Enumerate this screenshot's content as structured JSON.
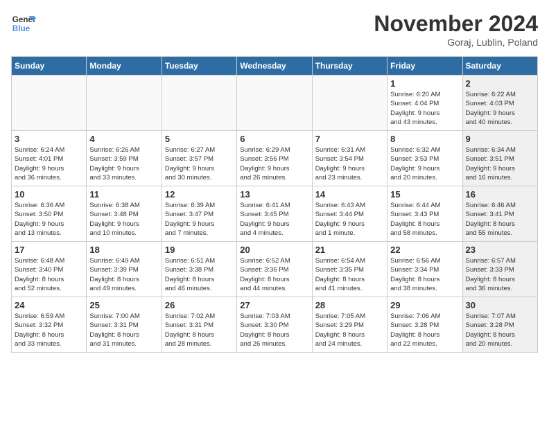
{
  "logo": {
    "line1": "General",
    "line2": "Blue"
  },
  "title": "November 2024",
  "subtitle": "Goraj, Lublin, Poland",
  "days_of_week": [
    "Sunday",
    "Monday",
    "Tuesday",
    "Wednesday",
    "Thursday",
    "Friday",
    "Saturday"
  ],
  "weeks": [
    [
      {
        "day": "",
        "text": "",
        "shaded": false,
        "empty": true
      },
      {
        "day": "",
        "text": "",
        "shaded": false,
        "empty": true
      },
      {
        "day": "",
        "text": "",
        "shaded": false,
        "empty": true
      },
      {
        "day": "",
        "text": "",
        "shaded": false,
        "empty": true
      },
      {
        "day": "",
        "text": "",
        "shaded": false,
        "empty": true
      },
      {
        "day": "1",
        "text": "Sunrise: 6:20 AM\nSunset: 4:04 PM\nDaylight: 9 hours\nand 43 minutes.",
        "shaded": false,
        "empty": false
      },
      {
        "day": "2",
        "text": "Sunrise: 6:22 AM\nSunset: 4:03 PM\nDaylight: 9 hours\nand 40 minutes.",
        "shaded": true,
        "empty": false
      }
    ],
    [
      {
        "day": "3",
        "text": "Sunrise: 6:24 AM\nSunset: 4:01 PM\nDaylight: 9 hours\nand 36 minutes.",
        "shaded": false,
        "empty": false
      },
      {
        "day": "4",
        "text": "Sunrise: 6:26 AM\nSunset: 3:59 PM\nDaylight: 9 hours\nand 33 minutes.",
        "shaded": false,
        "empty": false
      },
      {
        "day": "5",
        "text": "Sunrise: 6:27 AM\nSunset: 3:57 PM\nDaylight: 9 hours\nand 30 minutes.",
        "shaded": false,
        "empty": false
      },
      {
        "day": "6",
        "text": "Sunrise: 6:29 AM\nSunset: 3:56 PM\nDaylight: 9 hours\nand 26 minutes.",
        "shaded": false,
        "empty": false
      },
      {
        "day": "7",
        "text": "Sunrise: 6:31 AM\nSunset: 3:54 PM\nDaylight: 9 hours\nand 23 minutes.",
        "shaded": false,
        "empty": false
      },
      {
        "day": "8",
        "text": "Sunrise: 6:32 AM\nSunset: 3:53 PM\nDaylight: 9 hours\nand 20 minutes.",
        "shaded": false,
        "empty": false
      },
      {
        "day": "9",
        "text": "Sunrise: 6:34 AM\nSunset: 3:51 PM\nDaylight: 9 hours\nand 16 minutes.",
        "shaded": true,
        "empty": false
      }
    ],
    [
      {
        "day": "10",
        "text": "Sunrise: 6:36 AM\nSunset: 3:50 PM\nDaylight: 9 hours\nand 13 minutes.",
        "shaded": false,
        "empty": false
      },
      {
        "day": "11",
        "text": "Sunrise: 6:38 AM\nSunset: 3:48 PM\nDaylight: 9 hours\nand 10 minutes.",
        "shaded": false,
        "empty": false
      },
      {
        "day": "12",
        "text": "Sunrise: 6:39 AM\nSunset: 3:47 PM\nDaylight: 9 hours\nand 7 minutes.",
        "shaded": false,
        "empty": false
      },
      {
        "day": "13",
        "text": "Sunrise: 6:41 AM\nSunset: 3:45 PM\nDaylight: 9 hours\nand 4 minutes.",
        "shaded": false,
        "empty": false
      },
      {
        "day": "14",
        "text": "Sunrise: 6:43 AM\nSunset: 3:44 PM\nDaylight: 9 hours\nand 1 minute.",
        "shaded": false,
        "empty": false
      },
      {
        "day": "15",
        "text": "Sunrise: 6:44 AM\nSunset: 3:43 PM\nDaylight: 8 hours\nand 58 minutes.",
        "shaded": false,
        "empty": false
      },
      {
        "day": "16",
        "text": "Sunrise: 6:46 AM\nSunset: 3:41 PM\nDaylight: 8 hours\nand 55 minutes.",
        "shaded": true,
        "empty": false
      }
    ],
    [
      {
        "day": "17",
        "text": "Sunrise: 6:48 AM\nSunset: 3:40 PM\nDaylight: 8 hours\nand 52 minutes.",
        "shaded": false,
        "empty": false
      },
      {
        "day": "18",
        "text": "Sunrise: 6:49 AM\nSunset: 3:39 PM\nDaylight: 8 hours\nand 49 minutes.",
        "shaded": false,
        "empty": false
      },
      {
        "day": "19",
        "text": "Sunrise: 6:51 AM\nSunset: 3:38 PM\nDaylight: 8 hours\nand 46 minutes.",
        "shaded": false,
        "empty": false
      },
      {
        "day": "20",
        "text": "Sunrise: 6:52 AM\nSunset: 3:36 PM\nDaylight: 8 hours\nand 44 minutes.",
        "shaded": false,
        "empty": false
      },
      {
        "day": "21",
        "text": "Sunrise: 6:54 AM\nSunset: 3:35 PM\nDaylight: 8 hours\nand 41 minutes.",
        "shaded": false,
        "empty": false
      },
      {
        "day": "22",
        "text": "Sunrise: 6:56 AM\nSunset: 3:34 PM\nDaylight: 8 hours\nand 38 minutes.",
        "shaded": false,
        "empty": false
      },
      {
        "day": "23",
        "text": "Sunrise: 6:57 AM\nSunset: 3:33 PM\nDaylight: 8 hours\nand 36 minutes.",
        "shaded": true,
        "empty": false
      }
    ],
    [
      {
        "day": "24",
        "text": "Sunrise: 6:59 AM\nSunset: 3:32 PM\nDaylight: 8 hours\nand 33 minutes.",
        "shaded": false,
        "empty": false
      },
      {
        "day": "25",
        "text": "Sunrise: 7:00 AM\nSunset: 3:31 PM\nDaylight: 8 hours\nand 31 minutes.",
        "shaded": false,
        "empty": false
      },
      {
        "day": "26",
        "text": "Sunrise: 7:02 AM\nSunset: 3:31 PM\nDaylight: 8 hours\nand 28 minutes.",
        "shaded": false,
        "empty": false
      },
      {
        "day": "27",
        "text": "Sunrise: 7:03 AM\nSunset: 3:30 PM\nDaylight: 8 hours\nand 26 minutes.",
        "shaded": false,
        "empty": false
      },
      {
        "day": "28",
        "text": "Sunrise: 7:05 AM\nSunset: 3:29 PM\nDaylight: 8 hours\nand 24 minutes.",
        "shaded": false,
        "empty": false
      },
      {
        "day": "29",
        "text": "Sunrise: 7:06 AM\nSunset: 3:28 PM\nDaylight: 8 hours\nand 22 minutes.",
        "shaded": false,
        "empty": false
      },
      {
        "day": "30",
        "text": "Sunrise: 7:07 AM\nSunset: 3:28 PM\nDaylight: 8 hours\nand 20 minutes.",
        "shaded": true,
        "empty": false
      }
    ]
  ]
}
